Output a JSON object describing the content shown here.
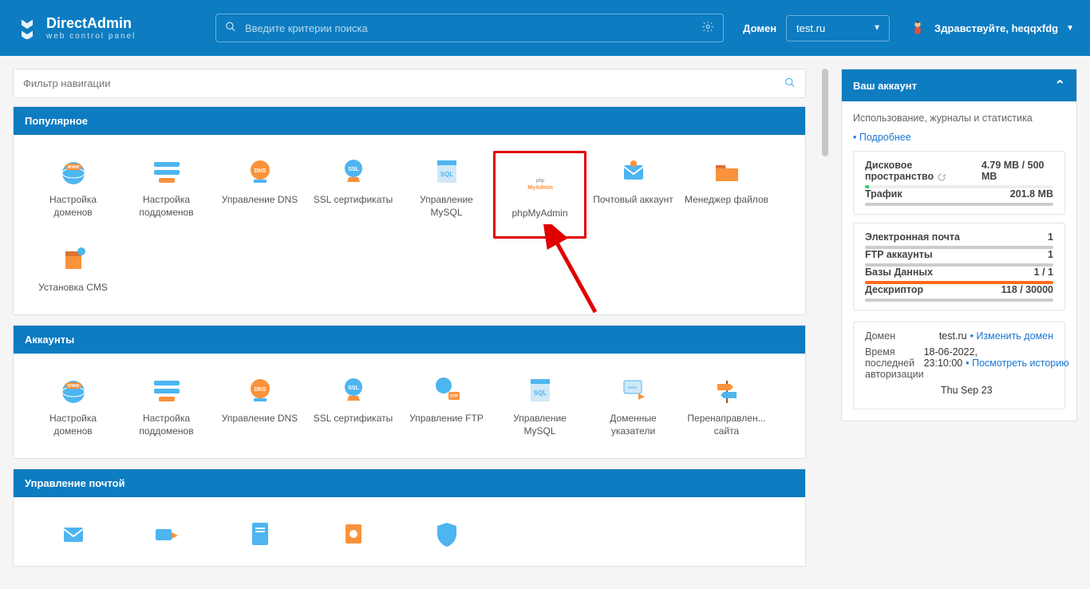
{
  "header": {
    "logo_title": "DirectAdmin",
    "logo_sub": "web control panel",
    "search_placeholder": "Введите критерии поиска",
    "domain_label": "Домен",
    "domain_value": "test.ru",
    "greeting": "Здравствуйте, heqqxfdg"
  },
  "filter": {
    "placeholder": "Фильтр навигации"
  },
  "sections": {
    "popular": {
      "title": "Популярное",
      "items": [
        {
          "label": "Настройка доменов",
          "icon": "globe-www"
        },
        {
          "label": "Настройка поддоменов",
          "icon": "subdomain"
        },
        {
          "label": "Управление DNS",
          "icon": "dns"
        },
        {
          "label": "SSL сертификаты",
          "icon": "ssl"
        },
        {
          "label": "Управление MySQL",
          "icon": "sql"
        },
        {
          "label": "phpMyAdmin",
          "icon": "phpmyadmin"
        },
        {
          "label": "Почтовый аккаунт",
          "icon": "mail"
        },
        {
          "label": "Менеджер файлов",
          "icon": "folder"
        },
        {
          "label": "Установка CMS",
          "icon": "box"
        }
      ]
    },
    "accounts": {
      "title": "Аккаунты",
      "items": [
        {
          "label": "Настройка доменов",
          "icon": "globe-www"
        },
        {
          "label": "Настройка поддоменов",
          "icon": "subdomain"
        },
        {
          "label": "Управление DNS",
          "icon": "dns"
        },
        {
          "label": "SSL сертификаты",
          "icon": "ssl"
        },
        {
          "label": "Управление FTP",
          "icon": "ftp"
        },
        {
          "label": "Управление MySQL",
          "icon": "sql"
        },
        {
          "label": "Доменные указатели",
          "icon": "pointer"
        },
        {
          "label": "Перенаправлен... сайта",
          "icon": "sign"
        }
      ]
    },
    "mail": {
      "title": "Управление почтой"
    }
  },
  "account_panel": {
    "title": "Ваш аккаунт",
    "subtitle": "Использование, журналы и статистика",
    "more": "Подробнее",
    "stats": {
      "disk_label": "Дисковое пространство",
      "disk_val": "4.79 MB / 500 MB",
      "traffic_label": "Трафик",
      "traffic_val": "201.8 MB",
      "email_label": "Электронная почта",
      "email_val": "1",
      "ftp_label": "FTP аккаунты",
      "ftp_val": "1",
      "db_label": "Базы Данных",
      "db_val": "1 / 1",
      "desc_label": "Дескриптор",
      "desc_val": "118 / 30000"
    },
    "info": {
      "domain_label": "Домен",
      "domain_val": "test.ru",
      "domain_link": "Изменить домен",
      "lastauth_label": "Время последней авторизации",
      "lastauth_val": "18-06-2022, 23:10:00",
      "lastauth_link": "Посмотреть историю",
      "date_val": "Thu Sep 23"
    }
  }
}
